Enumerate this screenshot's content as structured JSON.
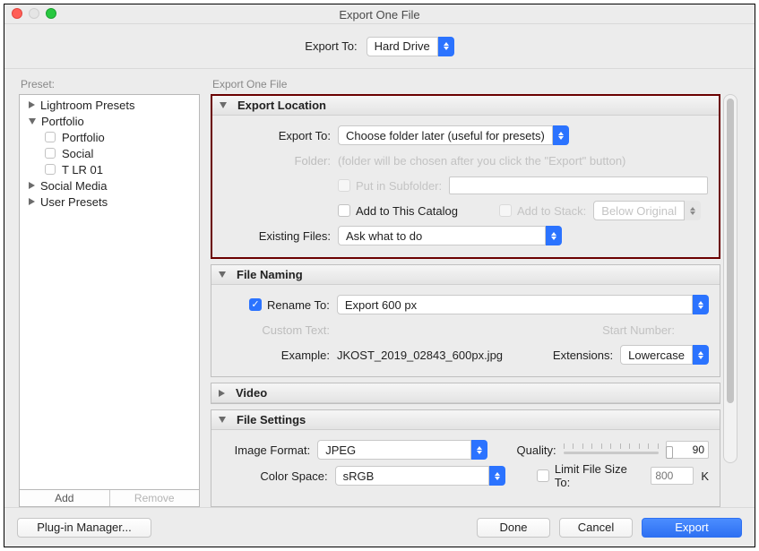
{
  "title": "Export One File",
  "toprow": {
    "label": "Export To:",
    "value": "Hard Drive"
  },
  "preset": {
    "label": "Preset:",
    "items": [
      {
        "label": "Lightroom Presets",
        "kind": "folder-closed"
      },
      {
        "label": "Portfolio",
        "kind": "folder-open"
      },
      {
        "label": "Portfolio",
        "kind": "child"
      },
      {
        "label": "Social",
        "kind": "child"
      },
      {
        "label": "T LR 01",
        "kind": "child"
      },
      {
        "label": "Social Media",
        "kind": "folder-closed"
      },
      {
        "label": "User Presets",
        "kind": "folder-closed"
      }
    ],
    "buttons": {
      "add": "Add",
      "remove": "Remove"
    }
  },
  "main": {
    "label": "Export One File",
    "sections": {
      "loc": {
        "header": "Export Location",
        "exportToLabel": "Export To:",
        "exportToValue": "Choose folder later (useful for presets)",
        "folderLabel": "Folder:",
        "folderNote": "(folder will be chosen after you click the \"Export\" button)",
        "putInSubfolder": "Put in Subfolder:",
        "addToCatalog": "Add to This Catalog",
        "addToStack": "Add to Stack:",
        "stackValue": "Below Original",
        "existingLabel": "Existing Files:",
        "existingValue": "Ask what to do"
      },
      "naming": {
        "header": "File Naming",
        "renameTo": "Rename To:",
        "renameValue": "Export 600 px",
        "customTextLabel": "Custom Text:",
        "startNumberLabel": "Start Number:",
        "exampleLabel": "Example:",
        "exampleValue": "JKOST_2019_02843_600px.jpg",
        "extensionsLabel": "Extensions:",
        "extensionsValue": "Lowercase"
      },
      "video": {
        "header": "Video"
      },
      "file": {
        "header": "File Settings",
        "imageFormatLabel": "Image Format:",
        "imageFormatValue": "JPEG",
        "qualityLabel": "Quality:",
        "qualityValue": "90",
        "colorSpaceLabel": "Color Space:",
        "colorSpaceValue": "sRGB",
        "limitFileSize": "Limit File Size To:",
        "limitPlaceholder": "800",
        "limitUnit": "K"
      }
    }
  },
  "footer": {
    "pluginManager": "Plug-in Manager...",
    "done": "Done",
    "cancel": "Cancel",
    "export": "Export"
  }
}
